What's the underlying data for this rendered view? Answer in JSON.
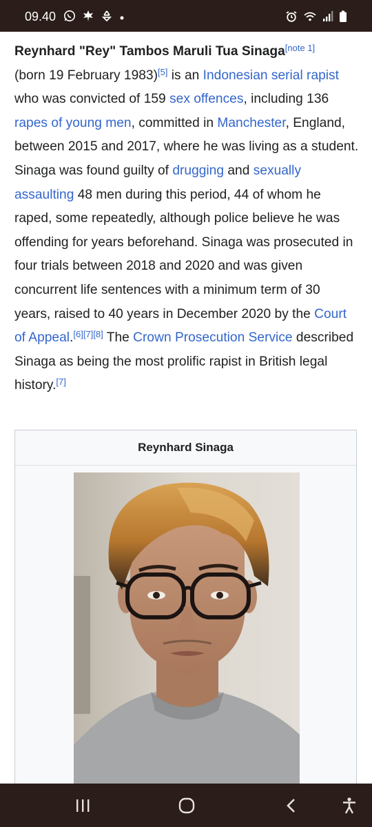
{
  "status_bar": {
    "time": "09.40",
    "left_icons": [
      "whatsapp-icon",
      "leaf-icon",
      "recycle-icon",
      "dot-icon"
    ],
    "right_icons": [
      "alarm-icon",
      "wifi-icon",
      "signal-icon",
      "battery-icon"
    ]
  },
  "article": {
    "name": "Reynhard \"Rey\" Tambos Maruli Tua Sinaga",
    "note": "[note 1]",
    "t1": "(born 19 February 1983)",
    "ref5": "[5]",
    "t2": " is an ",
    "link_serial_rapist": "Indonesian serial rapist",
    "t3": " who was convicted of 159 ",
    "link_sex_offences": "sex offences",
    "t4": ", including 136 ",
    "link_rapes_young_men": "rapes of young men",
    "t5": ", committed in ",
    "link_manchester": "Manchester",
    "t6": ", England, between 2015 and 2017, where he was living as a student. Sinaga was found guilty of ",
    "link_drugging": "drugging",
    "t7": " and ",
    "link_sexually_assaulting": "sexually assaulting",
    "t8": " 48 men during this period, 44 of whom he raped, some repeatedly, although police believe he was offending for years beforehand. Sinaga was prosecuted in four trials between 2018 and 2020 and was given concurrent life sentences with a minimum term of 30 years, raised to 40 years in December 2020 by the ",
    "link_court_of_appeal": "Court of Appeal",
    "t9": ".",
    "ref6": "[6]",
    "ref7a": "[7]",
    "ref8": "[8]",
    "t10": " The ",
    "link_cps": "Crown Prosecution Service",
    "t11": " described Sinaga as being the most prolific rapist in British legal history.",
    "ref7b": "[7]"
  },
  "infobox": {
    "title": "Reynhard Sinaga"
  },
  "nav_bar": {
    "buttons": [
      "recent-apps-icon",
      "home-icon",
      "back-icon",
      "accessibility-icon"
    ]
  },
  "colors": {
    "link": "#3366cc",
    "bars": "#2b1d19",
    "text": "#202122",
    "infobox_bg": "#f8f9fa",
    "infobox_border": "#c8ccd1"
  }
}
